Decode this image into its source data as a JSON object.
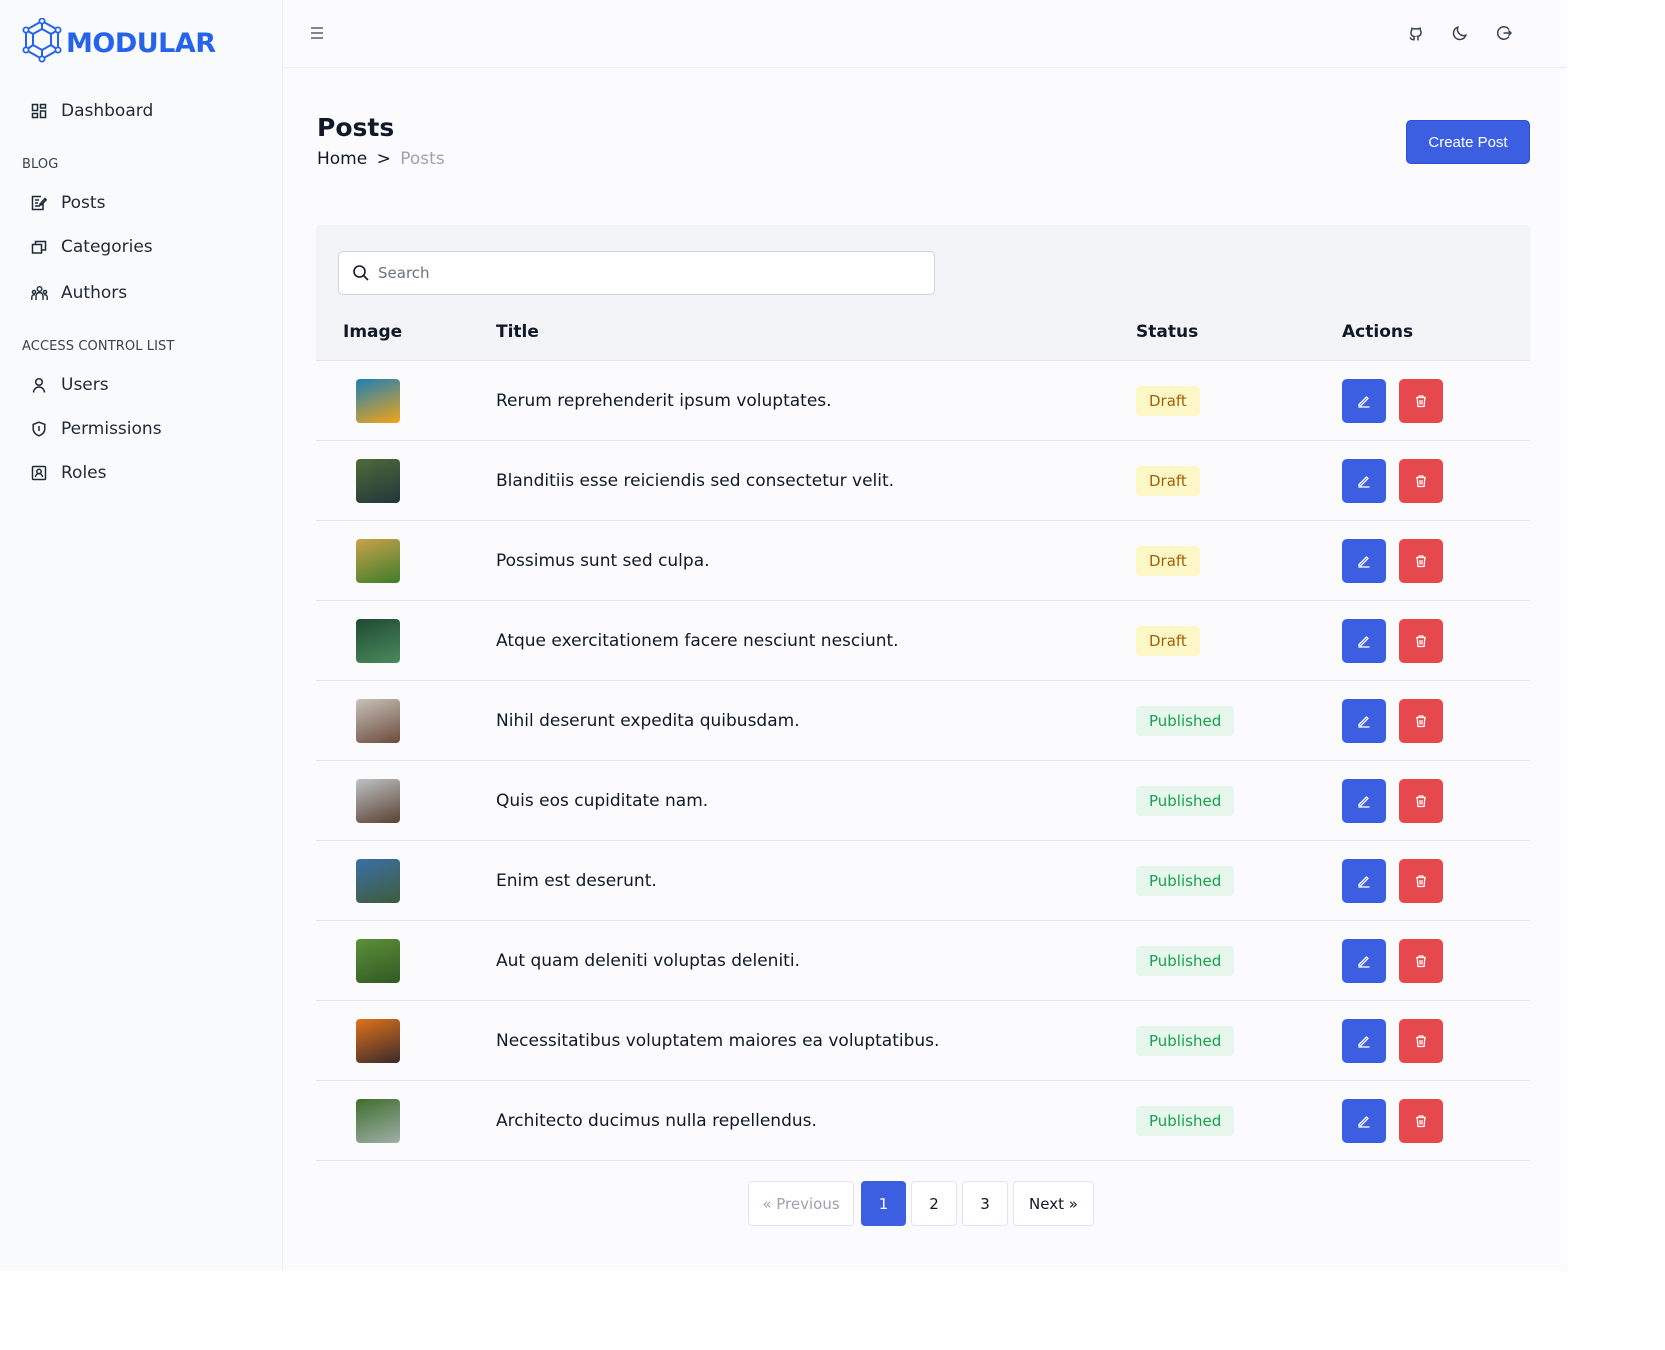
{
  "app": {
    "brand": "MODULAR",
    "accent": "#2563eb"
  },
  "sidebar": {
    "dashboard": {
      "label": "Dashboard",
      "icon": "dashboard-icon"
    },
    "sections": [
      {
        "title": "BLOG",
        "items": [
          {
            "label": "Posts",
            "icon": "posts-icon"
          },
          {
            "label": "Categories",
            "icon": "categories-icon"
          },
          {
            "label": "Authors",
            "icon": "authors-icon"
          }
        ]
      },
      {
        "title": "ACCESS CONTROL LIST",
        "items": [
          {
            "label": "Users",
            "icon": "user-icon"
          },
          {
            "label": "Permissions",
            "icon": "shield-icon"
          },
          {
            "label": "Roles",
            "icon": "id-badge-icon"
          }
        ]
      }
    ]
  },
  "topbar": {
    "icons": [
      "menu-icon",
      "github-icon",
      "moon-icon",
      "logout-icon"
    ]
  },
  "page": {
    "title": "Posts",
    "breadcrumb": {
      "home": "Home",
      "separator": ">",
      "current": "Posts"
    },
    "create_label": "Create Post"
  },
  "table": {
    "search_placeholder": "Search",
    "columns": {
      "image": "Image",
      "title": "Title",
      "status": "Status",
      "actions": "Actions"
    },
    "rows": [
      {
        "title": "Rerum reprehenderit ipsum voluptates.",
        "status": "Draft",
        "thumb": [
          "#1d7fb8",
          "#f2a516"
        ]
      },
      {
        "title": "Blanditiis esse reiciendis sed consectetur velit.",
        "status": "Draft",
        "thumb": [
          "#4e6b3a",
          "#23353a"
        ]
      },
      {
        "title": "Possimus sunt sed culpa.",
        "status": "Draft",
        "thumb": [
          "#c9a24a",
          "#3e7d2c"
        ]
      },
      {
        "title": "Atque exercitationem facere nesciunt nesciunt.",
        "status": "Draft",
        "thumb": [
          "#1f4a33",
          "#4a8a5c"
        ]
      },
      {
        "title": "Nihil deserunt expedita quibusdam.",
        "status": "Published",
        "thumb": [
          "#c7c2bb",
          "#6d4b3a"
        ]
      },
      {
        "title": "Quis eos cupiditate nam.",
        "status": "Published",
        "thumb": [
          "#bfc3c6",
          "#5a4030"
        ]
      },
      {
        "title": "Enim est deserunt.",
        "status": "Published",
        "thumb": [
          "#3b6fa8",
          "#3f5c3a"
        ]
      },
      {
        "title": "Aut quam deleniti voluptas deleniti.",
        "status": "Published",
        "thumb": [
          "#5d8f3a",
          "#2f5a22"
        ]
      },
      {
        "title": "Necessitatibus voluptatem maiores ea voluptatibus.",
        "status": "Published",
        "thumb": [
          "#e0721c",
          "#3a2a2a"
        ]
      },
      {
        "title": "Architecto ducimus nulla repellendus.",
        "status": "Published",
        "thumb": [
          "#3f6d2e",
          "#9fb0a8"
        ]
      }
    ]
  },
  "pagination": {
    "previous": "« Previous",
    "pages": [
      "1",
      "2",
      "3"
    ],
    "current": "1",
    "next": "Next »"
  },
  "colors": {
    "primary": "#3b5fe0",
    "danger": "#e5484d",
    "draft_bg": "#fdf6c6",
    "draft_fg": "#a16207",
    "published_bg": "#e7f6ec",
    "published_fg": "#16a34a"
  }
}
